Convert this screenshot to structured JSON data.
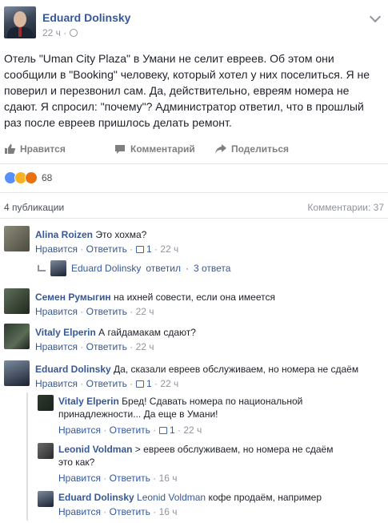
{
  "post": {
    "author": "Eduard Dolinsky",
    "time": "22 ч",
    "separator": "·",
    "text": "Отель \"Uman City Plaza\" в Умани не селит евреев. Об этом они сообщили в \"Booking\" человеку, который хотел у них поселиться. Я не поверил и перезвонил сам. Да, действительно, евреям номера не сдают. Я спросил: \"почему\"? Администратор ответил, что в прошлый раз после евреев пришлось делать ремонт."
  },
  "actions": {
    "like": "Нравится",
    "comment": "Комментарий",
    "share": "Поделиться"
  },
  "reactions": {
    "count": "68"
  },
  "footer": {
    "shares": "4 публикации",
    "comments": "Комментарии: 37"
  },
  "comments": [
    {
      "name": "Alina Roizen",
      "text": "Это хохма?",
      "like": "Нравится",
      "reply": "Ответить",
      "likes": "1",
      "time": "22 ч"
    },
    {
      "name": "Семен Румыгин",
      "text": "на ихней совести, если она имеется",
      "like": "Нравится",
      "reply": "Ответить",
      "time": "22 ч"
    },
    {
      "name": "Vitaly Elperin",
      "text": "А гайдамакам сдают?",
      "like": "Нравится",
      "reply": "Ответить",
      "time": "22 ч"
    },
    {
      "name": "Eduard Dolinsky",
      "text": "Да, сказали евреев обслуживаем, но номера не сдаём",
      "like": "Нравится",
      "reply": "Ответить",
      "likes": "1",
      "time": "22 ч"
    }
  ],
  "replies_summary": {
    "name": "Eduard Dolinsky",
    "action": "ответил",
    "count": "3 ответа"
  },
  "replies": [
    {
      "name": "Vitaly Elperin",
      "text_line1": "Бред! Сдавать номера по национальной",
      "text_line2": "принадлежности... Да еще в Умани!",
      "like": "Нравится",
      "reply": "Ответить",
      "likes": "1",
      "time": "22 ч"
    },
    {
      "name": "Leonid Voldman",
      "text_line1": "> евреев обслуживаем, но номера не сдаём",
      "text_line2": "это как?",
      "like": "Нравится",
      "reply": "Ответить",
      "time": "16 ч"
    },
    {
      "name": "Eduard Dolinsky",
      "mention": "Leonid Voldman",
      "text": "кофе продаём, например",
      "like": "Нравится",
      "reply": "Ответить",
      "time": "16 ч"
    }
  ],
  "dot": "·"
}
